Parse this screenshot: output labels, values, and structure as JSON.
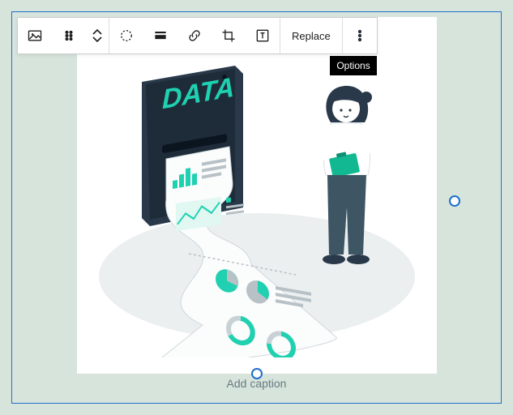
{
  "toolbar": {
    "replace_label": "Replace",
    "options_tooltip": "Options"
  },
  "image": {
    "label_text": "DATA"
  },
  "caption_placeholder": "Add caption"
}
